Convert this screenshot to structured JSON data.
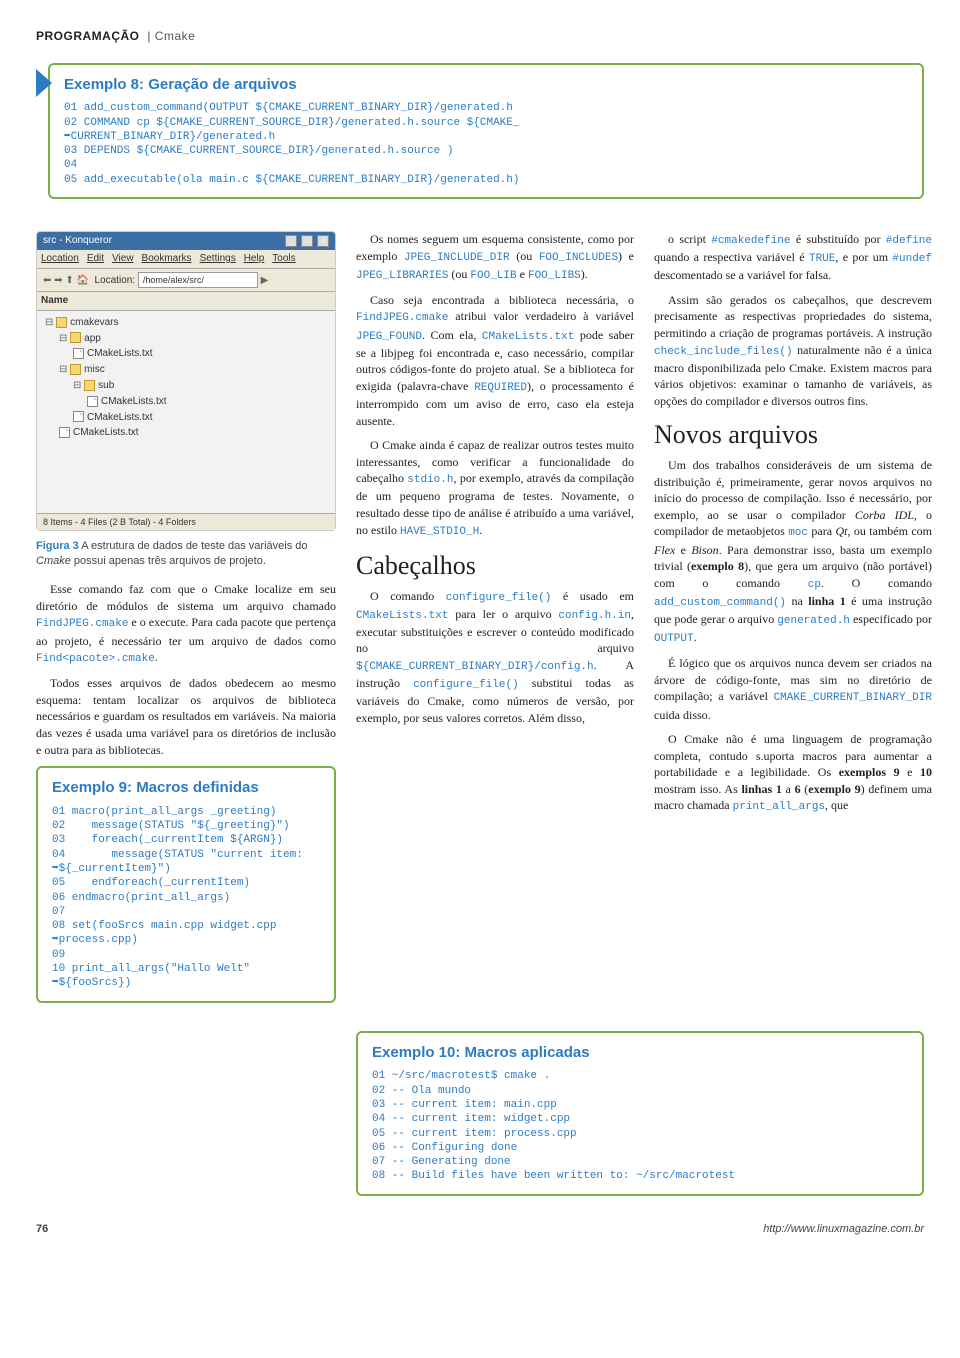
{
  "header": {
    "section": "PROGRAMAÇÃO",
    "sub": "Cmake"
  },
  "example8": {
    "title": "Exemplo 8: Geração de arquivos",
    "lines": [
      "01 add_custom_command(OUTPUT ${CMAKE_CURRENT_BINARY_DIR}/generated.h",
      "02 COMMAND cp ${CMAKE_CURRENT_SOURCE_DIR}/generated.h.source ${CMAKE_",
      "➥CURRENT_BINARY_DIR}/generated.h",
      "03 DEPENDS ${CMAKE_CURRENT_SOURCE_DIR}/generated.h.source )",
      "04",
      "05 add_executable(ola main.c ${CMAKE_CURRENT_BINARY_DIR}/generated.h)"
    ]
  },
  "figure": {
    "titlebar": "src - Konqueror",
    "menu": [
      "Location",
      "Edit",
      "View",
      "Bookmarks",
      "Settings",
      "Help",
      "Tools"
    ],
    "location_label": "Location:",
    "location_value": "/home/alex/src/",
    "name_header": "Name",
    "tree": {
      "root": "cmakevars",
      "app": "app",
      "app_file": "CMakeLists.txt",
      "misc": "misc",
      "sub": "sub",
      "sub_file": "CMakeLists.txt",
      "misc_file": "CMakeLists.txt",
      "root_file": "CMakeLists.txt"
    },
    "status": "8 Items - 4 Files (2 B Total) - 4 Folders",
    "caption_label": "Figura 3",
    "caption_text_a": " A estrutura de dados de teste das variáveis do ",
    "caption_text_b": "Cmake",
    "caption_text_c": " possui apenas três arquivos de projeto."
  },
  "left_body": {
    "p1_a": "Esse comando faz com que o Cmake localize em seu diretório de módulos de sistema um arquivo chamado ",
    "p1_code1": "FindJPEG.cmake",
    "p1_b": " e o execute. Para cada pacote que pertença ao projeto, é necessário ter um arquivo de dados como ",
    "p1_code2": "Find<pacote>.cmake",
    "p1_c": ".",
    "p2": "Todos esses arquivos de dados obedecem ao mesmo esquema: tentam localizar os arquivos de biblioteca necessários e guardam os resultados em variáveis. Na maioria das vezes é usada uma variável para os diretórios de inclusão e outra para as bibliotecas."
  },
  "example9": {
    "title": "Exemplo 9: Macros definidas",
    "lines": [
      "01 macro(print_all_args _greeting)",
      "02    message(STATUS \"${_greeting}\")",
      "03    foreach(_currentItem ${ARGN})",
      "04       message(STATUS \"current item:",
      "➥${_currentItem}\")",
      "05    endforeach(_currentItem)",
      "06 endmacro(print_all_args)",
      "07",
      "08 set(fooSrcs main.cpp widget.cpp",
      "➥process.cpp)",
      "09",
      "10 print_all_args(\"Hallo Welt\"",
      "➥${fooSrcs})"
    ]
  },
  "mid_body": {
    "p1_a": "Os nomes seguem um esquema consistente, como por exemplo ",
    "p1_c1": "JPEG_INCLUDE_DIR",
    "p1_b": " (ou ",
    "p1_c2": "FOO_INCLUDES",
    "p1_c": ") e ",
    "p1_c3": "JPEG_LIBRARIES",
    "p1_d": " (ou ",
    "p1_c4": "FOO_LIB",
    "p1_e": " e ",
    "p1_c5": "FOO_LIBS",
    "p1_f": ").",
    "p2_a": "Caso seja encontrada a biblioteca necessária, o ",
    "p2_c1": "FindJPEG.cmake",
    "p2_b": " atribui valor verdadeiro à variável ",
    "p2_c2": "JPEG_FOUND",
    "p2_c": ". Com ela, ",
    "p2_c3": "CMakeLists.txt",
    "p2_d": " pode saber se a libjpeg foi encontrada e, caso necessário, compilar outros códigos-fonte do projeto atual. Se a biblioteca for exigida (palavra-chave ",
    "p2_c4": "REQUIRED",
    "p2_e": "), o processamento é interrompido com um aviso de erro, caso ela esteja ausente.",
    "p3_a": "O Cmake ainda é capaz de realizar outros testes muito interessantes, como verificar a funcionalidade do cabeçalho ",
    "p3_c1": "stdio.h",
    "p3_b": ", por exemplo, através da compilação de um pequeno programa de testes. Novamente, o resultado desse tipo de análise é atribuído a uma variável, no estilo ",
    "p3_c2": "HAVE_STDIO_H",
    "p3_c": ".",
    "h_cabecalhos": "Cabeçalhos",
    "p4_a": "O comando ",
    "p4_c1": "configure_file()",
    "p4_b": " é usado em ",
    "p4_c2": "CMakeLists.txt",
    "p4_c": " para ler o arquivo ",
    "p4_c3": "config.h.in",
    "p4_d": ", executar substituições e escrever o conteúdo modificado no arquivo ",
    "p4_c4": "${CMAKE_CURRENT_BINARY_DIR}/config.h",
    "p4_e": ". A instrução ",
    "p4_c5": "configure_file()",
    "p4_f": " substitui todas as variáveis do Cmake, como números de versão, por exemplo, por seus valores corretos. Além disso,"
  },
  "right_body": {
    "p1_a": "o script ",
    "p1_c1": "#cmakedefine",
    "p1_b": " é substituído por ",
    "p1_c2": "#define",
    "p1_c": " quando a respectiva variável é ",
    "p1_c3": "TRUE",
    "p1_d": ", e por um ",
    "p1_c4": "#undef",
    "p1_e": " descomentado se a variável for falsa.",
    "p2_a": "Assim são gerados os cabeçalhos, que descrevem precisamente as respectivas propriedades do sistema, permitindo a criação de programas portáveis. A instrução ",
    "p2_c1": "check_include_files()",
    "p2_b": " naturalmente não é a única macro disponibilizada pelo Cmake. Existem macros para vários objetivos: examinar o tamanho de variáveis, as opções do compilador e diversos outros fins.",
    "h_novos": "Novos arquivos",
    "p3_a": "Um dos trabalhos consideráveis de um sistema de distribuição é, primeiramente, gerar novos arquivos no início do processo de compilação. Isso é necessário, por exemplo, ao se usar o compilador ",
    "p3_i1": "Corba IDL",
    "p3_b": ", o compilador de metaobjetos ",
    "p3_c1": "moc",
    "p3_c": " para ",
    "p3_i2": "Qt",
    "p3_d": ", ou também com ",
    "p3_i3": "Flex",
    "p3_e": " e ",
    "p3_i4": "Bison",
    "p3_f": ". Para demonstrar isso, basta um exemplo trivial (",
    "p3_bold1": "exemplo 8",
    "p3_g": "), que gera um arquivo (não portável) com o comando ",
    "p3_c2": "cp",
    "p3_h": ". O comando ",
    "p3_c3": "add_custom_command()",
    "p3_i": " na ",
    "p3_bold2": "linha 1",
    "p3_j": " é uma instrução que pode gerar o arquivo ",
    "p3_c4": "generated.h",
    "p3_k": " especificado por ",
    "p3_c5": "OUTPUT",
    "p3_l": ".",
    "p4_a": "É lógico que os arquivos nunca devem ser criados na árvore de código-fonte, mas sim no diretório de compilação; a variável ",
    "p4_c1": "CMAKE_CURRENT_BINARY_DIR",
    "p4_b": " cuida disso.",
    "p5_a": "O Cmake não é uma linguagem de programação completa, contudo s.uporta macros para aumentar a portabilidade e a legibilidade. Os ",
    "p5_bold1": "exemplos 9",
    "p5_b": " e ",
    "p5_bold2": "10",
    "p5_c": " mostram isso. As ",
    "p5_bold3": "linhas 1",
    "p5_d": " a ",
    "p5_bold4": "6",
    "p5_e": " (",
    "p5_bold5": "exemplo 9",
    "p5_f": ") definem uma macro chamada ",
    "p5_c1": "print_all_args",
    "p5_g": ", que"
  },
  "example10": {
    "title": "Exemplo 10: Macros aplicadas",
    "lines": [
      "01 ~/src/macrotest$ cmake .",
      "02 -- Ola mundo",
      "03 -- current item: main.cpp",
      "04 -- current item: widget.cpp",
      "05 -- current item: process.cpp",
      "06 -- Configuring done",
      "07 -- Generating done",
      "08 -- Build files have been written to: ~/src/macrotest"
    ]
  },
  "footer": {
    "page": "76",
    "url": "http://www.linuxmagazine.com.br"
  }
}
